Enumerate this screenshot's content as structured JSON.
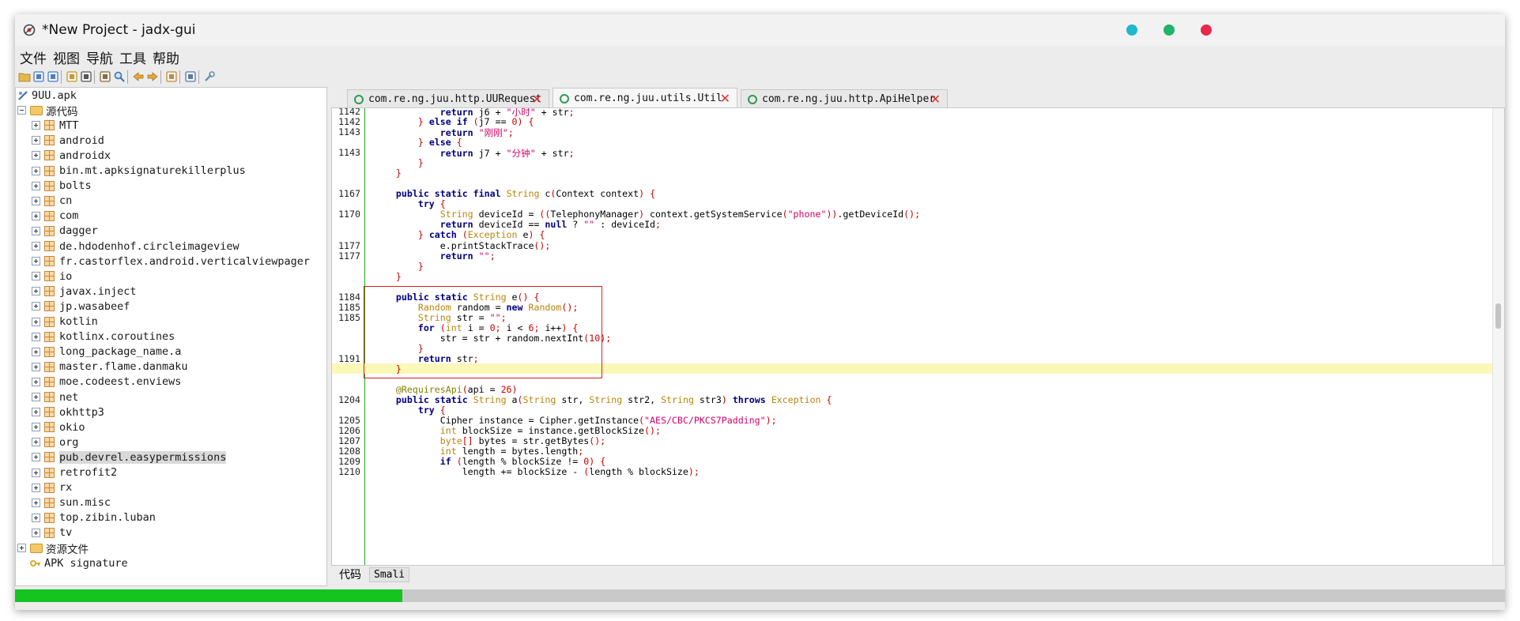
{
  "window": {
    "title": "*New Project - jadx-gui",
    "controls": [
      {
        "name": "minimize",
        "color": "#1fb7c9"
      },
      {
        "name": "maximize",
        "color": "#1fb36b"
      },
      {
        "name": "close",
        "color": "#e8294a"
      }
    ]
  },
  "menu": [
    "文件",
    "视图",
    "导航",
    "工具",
    "帮助"
  ],
  "toolbar": [
    "open-file-icon",
    "save-icon",
    "save-all-icon",
    "sync-icon",
    "flatten-icon",
    "deobfuscate-icon",
    "search-icon",
    "back-icon",
    "forward-icon",
    "decompile-icon",
    "log-icon",
    "preferences-icon"
  ],
  "tree": {
    "root": "9UU.apk",
    "source_label": "源代码",
    "packages": [
      "MTT",
      "android",
      "androidx",
      "bin.mt.apksignaturekillerplus",
      "bolts",
      "cn",
      "com",
      "dagger",
      "de.hdodenhof.circleimageview",
      "fr.castorflex.android.verticalviewpager",
      "io",
      "javax.inject",
      "jp.wasabeef",
      "kotlin",
      "kotlinx.coroutines",
      "long_package_name.a",
      "master.flame.danmaku",
      "moe.codeest.enviews",
      "net",
      "okhttp3",
      "okio",
      "org",
      "pub.devrel.easypermissions",
      "retrofit2",
      "rx",
      "sun.misc",
      "top.zibin.luban",
      "tv"
    ],
    "selected": "pub.devrel.easypermissions",
    "resources_label": "资源文件",
    "signature_label": "APK signature"
  },
  "tabs": [
    {
      "label": "com.re.ng.juu.http.UURequest"
    },
    {
      "label": "com.re.ng.juu.utils.Util",
      "active": true
    },
    {
      "label": "com.re.ng.juu.http.ApiHelper"
    }
  ],
  "code": [
    {
      "n": "1142",
      "t": "            return j6 + \"小时\" + str;"
    },
    {
      "n": "1142",
      "t": "        } else if (j7 == 0) {"
    },
    {
      "n": "1143",
      "t": "            return \"刚刚\";"
    },
    {
      "n": "",
      "t": "        } else {"
    },
    {
      "n": "1143",
      "t": "            return j7 + \"分钟\" + str;"
    },
    {
      "n": "",
      "t": "        }"
    },
    {
      "n": "",
      "t": "    }"
    },
    {
      "n": "",
      "t": ""
    },
    {
      "n": "1167",
      "t": "    public static final String c(Context context) {"
    },
    {
      "n": "",
      "t": "        try {"
    },
    {
      "n": "1170",
      "t": "            String deviceId = ((TelephonyManager) context.getSystemService(\"phone\")).getDeviceId();"
    },
    {
      "n": "",
      "t": "            return deviceId == null ? \"\" : deviceId;"
    },
    {
      "n": "",
      "t": "        } catch (Exception e) {"
    },
    {
      "n": "1177",
      "t": "            e.printStackTrace();"
    },
    {
      "n": "1177",
      "t": "            return \"\";"
    },
    {
      "n": "",
      "t": "        }"
    },
    {
      "n": "",
      "t": "    }"
    },
    {
      "n": "",
      "t": ""
    },
    {
      "n": "1184",
      "t": "    public static String e() {"
    },
    {
      "n": "1185",
      "t": "        Random random = new Random();"
    },
    {
      "n": "1185",
      "t": "        String str = \"\";"
    },
    {
      "n": "",
      "t": "        for (int i = 0; i < 6; i++) {"
    },
    {
      "n": "",
      "t": "            str = str + random.nextInt(10);"
    },
    {
      "n": "",
      "t": "        }"
    },
    {
      "n": "1191",
      "t": "        return str;"
    },
    {
      "n": "",
      "t": "    }",
      "hl": true
    },
    {
      "n": "",
      "t": ""
    },
    {
      "n": "",
      "t": "    @RequiresApi(api = 26)"
    },
    {
      "n": "1204",
      "t": "    public static String a(String str, String str2, String str3) throws Exception {"
    },
    {
      "n": "",
      "t": "        try {"
    },
    {
      "n": "1205",
      "t": "            Cipher instance = Cipher.getInstance(\"AES/CBC/PKCS7Padding\");"
    },
    {
      "n": "1206",
      "t": "            int blockSize = instance.getBlockSize();"
    },
    {
      "n": "1207",
      "t": "            byte[] bytes = str.getBytes();"
    },
    {
      "n": "1208",
      "t": "            int length = bytes.length;"
    },
    {
      "n": "1209",
      "t": "            if (length % blockSize != 0) {"
    },
    {
      "n": "1210",
      "t": "                length += blockSize - (length % blockSize);"
    }
  ],
  "bottom_tabs": [
    "代码",
    "Smali"
  ],
  "progress": {
    "fraction": 0.26,
    "color": "#16c420"
  }
}
